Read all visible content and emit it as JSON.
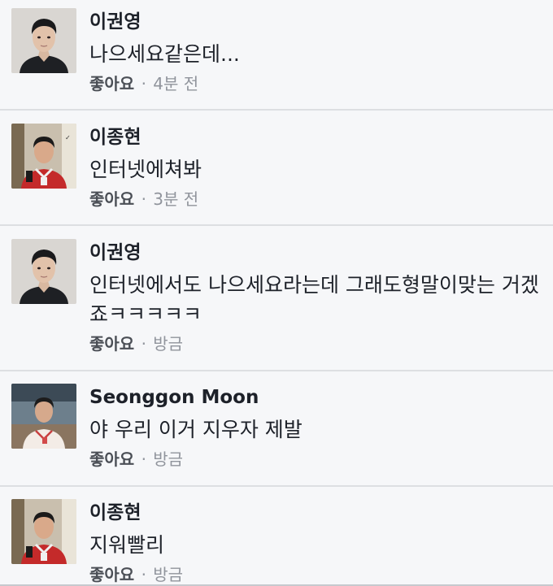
{
  "comments": [
    {
      "author": "이권영",
      "text": "나으세요같은데...",
      "like_label": "좋아요",
      "separator": "·",
      "time": "4분 전",
      "avatar_icon": "profile-photo-school-portrait"
    },
    {
      "author": "이종현",
      "text": "인터넷에쳐봐",
      "like_label": "좋아요",
      "separator": "·",
      "time": "3분 전",
      "avatar_icon": "profile-photo-red-jersey"
    },
    {
      "author": "이권영",
      "text": "인터넷에서도 나으세요라는데 그래도형말이맞는 거겠죠ㅋㅋㅋㅋㅋ",
      "like_label": "좋아요",
      "separator": "·",
      "time": "방금",
      "avatar_icon": "profile-photo-school-portrait"
    },
    {
      "author": "Seonggon Moon",
      "text": "야 우리 이거 지우자 제발",
      "like_label": "좋아요",
      "separator": "·",
      "time": "방금",
      "avatar_icon": "profile-photo-white-jersey"
    },
    {
      "author": "이종현",
      "text": "지워빨리",
      "like_label": "좋아요",
      "separator": "·",
      "time": "방금",
      "avatar_icon": "profile-photo-red-jersey"
    }
  ],
  "colors": {
    "background": "#f6f7f9",
    "text": "#1d2129",
    "like": "#4b4f56",
    "meta": "#90949c",
    "divider": "#dddfe2"
  }
}
